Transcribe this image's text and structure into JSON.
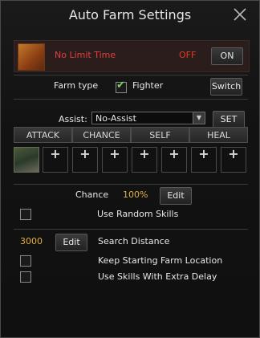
{
  "window": {
    "title": "Auto Farm Settings"
  },
  "limit": {
    "label": "No Limit Time",
    "status": "OFF",
    "button": "ON"
  },
  "farm_type": {
    "label": "Farm type",
    "option": "Fighter",
    "checked": true,
    "switch_button": "Switch"
  },
  "assist": {
    "label": "Assist:",
    "value": "No-Assist",
    "set_button": "SET"
  },
  "tabs": [
    "ATTACK",
    "CHANCE",
    "SELF",
    "HEAL"
  ],
  "skill_slots": {
    "add_symbol": "+",
    "count": 8
  },
  "chance": {
    "label": "Chance",
    "value": "100%",
    "edit_button": "Edit"
  },
  "random_skills": {
    "label": "Use Random Skills",
    "checked": false
  },
  "search": {
    "value": "3000",
    "edit_button": "Edit",
    "label": "Search Distance"
  },
  "keep_location": {
    "label": "Keep Starting Farm Location",
    "checked": false
  },
  "extra_delay": {
    "label": "Use Skills With Extra Delay",
    "checked": false
  },
  "colors": {
    "off": "#e03a2a",
    "limit_text": "#e04040",
    "value": "#e0b040",
    "check": "#7fd36a"
  },
  "icons": {
    "close": "close-icon",
    "limit": "scroll-icon",
    "skill": "warrior-skill-icon",
    "dropdown": "chevron-down-icon"
  }
}
